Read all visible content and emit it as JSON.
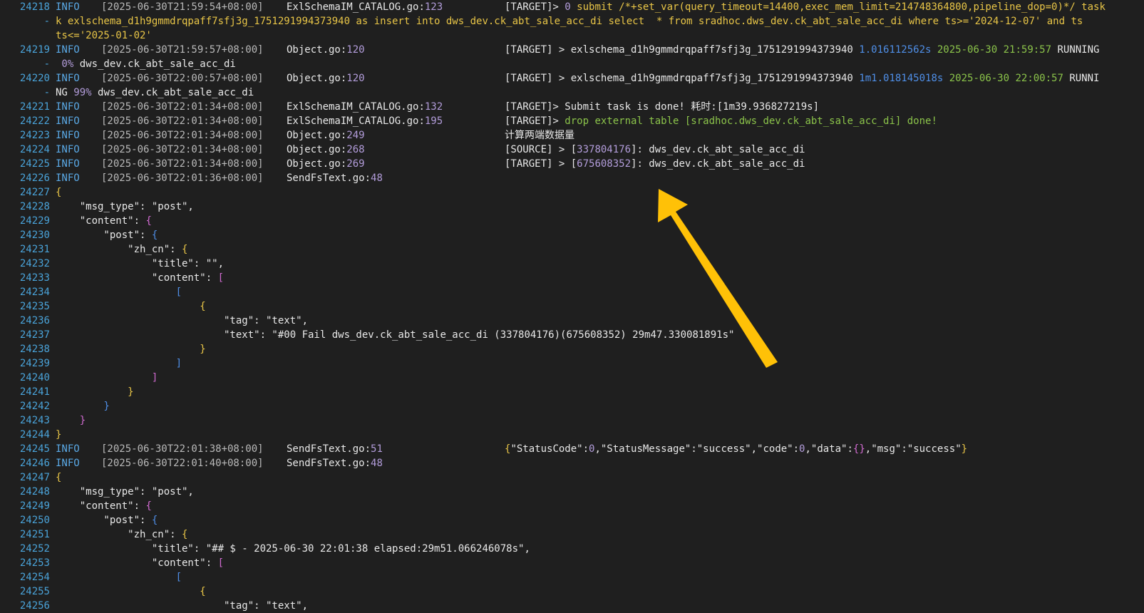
{
  "lines": [
    {
      "n": "24218",
      "lvl": "INFO",
      "ts": "[2025-06-30T21:59:54+08:00]",
      "file": "ExlSchemaIM_CATALOG.go",
      "line": "123",
      "msg": [
        {
          "t": "[TARGET]> ",
          "c": ""
        },
        {
          "t": "0",
          "c": "num"
        },
        {
          "t": " submit /*+set_var(query_timeout=14400,exec_mem_limit=214748364800,pipeline_dop=0)*/ task",
          "c": "yellow"
        }
      ]
    },
    {
      "n": "-",
      "cont": [
        {
          "t": "k exlschema_d1h9gmmdrqpaff7sfj3g_1751291994373940 as insert into dws_dev.ck_abt_sale_acc_di select  * from sradhoc.dws_dev.ck_abt_sale_acc_di where ts>='2024-12-07' and ts",
          "c": "yellow"
        }
      ]
    },
    {
      "n": "",
      "cont": [
        {
          "t": "ts<='2025-01-02'",
          "c": "yellow"
        }
      ]
    },
    {
      "n": "24219",
      "lvl": "INFO",
      "ts": "[2025-06-30T21:59:57+08:00]",
      "file": "Object.go",
      "line": "120",
      "msg": [
        {
          "t": "[TARGET] > exlschema_d1h9gmmdrqpaff7sfj3g_1751291994373940 ",
          "c": ""
        },
        {
          "t": "1.016112562s",
          "c": "blue"
        },
        {
          "t": " 2025-06-30 21:59:57 ",
          "c": "green"
        },
        {
          "t": "RUNNING",
          "c": ""
        }
      ]
    },
    {
      "n": "-",
      "cont": [
        {
          "t": " 0% ",
          "c": "num"
        },
        {
          "t": "dws_dev.ck_abt_sale_acc_di",
          "c": ""
        }
      ]
    },
    {
      "n": "24220",
      "lvl": "INFO",
      "ts": "[2025-06-30T22:00:57+08:00]",
      "file": "Object.go",
      "line": "120",
      "msg": [
        {
          "t": "[TARGET] > exlschema_d1h9gmmdrqpaff7sfj3g_1751291994373940 ",
          "c": ""
        },
        {
          "t": "1m1.018145018s",
          "c": "blue"
        },
        {
          "t": " 2025-06-30 22:00:57 ",
          "c": "green"
        },
        {
          "t": "RUNNI",
          "c": ""
        }
      ]
    },
    {
      "n": "-",
      "cont": [
        {
          "t": "NG ",
          "c": ""
        },
        {
          "t": "99%",
          "c": "num"
        },
        {
          "t": " dws_dev.ck_abt_sale_acc_di",
          "c": ""
        }
      ]
    },
    {
      "n": "24221",
      "lvl": "INFO",
      "ts": "[2025-06-30T22:01:34+08:00]",
      "file": "ExlSchemaIM_CATALOG.go",
      "line": "132",
      "msg": [
        {
          "t": "[TARGET]> Submit task is done! 耗时:",
          "c": ""
        },
        {
          "t": "[1m39.936827219s]",
          "c": ""
        }
      ]
    },
    {
      "n": "24222",
      "lvl": "INFO",
      "ts": "[2025-06-30T22:01:34+08:00]",
      "file": "ExlSchemaIM_CATALOG.go",
      "line": "195",
      "msg": [
        {
          "t": "[TARGET]> ",
          "c": ""
        },
        {
          "t": "drop external table [sradhoc.dws_dev.ck_abt_sale_acc_di] done!",
          "c": "green"
        }
      ]
    },
    {
      "n": "24223",
      "lvl": "INFO",
      "ts": "[2025-06-30T22:01:34+08:00]",
      "file": "Object.go",
      "line": "249",
      "msg": [
        {
          "t": "计算两端数据量",
          "c": ""
        }
      ]
    },
    {
      "n": "24224",
      "lvl": "INFO",
      "ts": "[2025-06-30T22:01:34+08:00]",
      "file": "Object.go",
      "line": "268",
      "msg": [
        {
          "t": "[SOURCE] > [",
          "c": ""
        },
        {
          "t": "337804176",
          "c": "num"
        },
        {
          "t": "]: dws_dev.ck_abt_sale_acc_di",
          "c": ""
        }
      ]
    },
    {
      "n": "24225",
      "lvl": "INFO",
      "ts": "[2025-06-30T22:01:34+08:00]",
      "file": "Object.go",
      "line": "269",
      "msg": [
        {
          "t": "[TARGET] > [",
          "c": ""
        },
        {
          "t": "675608352",
          "c": "num"
        },
        {
          "t": "]: dws_dev.ck_abt_sale_acc_di",
          "c": ""
        }
      ]
    },
    {
      "n": "24226",
      "lvl": "INFO",
      "ts": "[2025-06-30T22:01:36+08:00]",
      "file": "SendFsText.go",
      "line": "48",
      "msg": []
    },
    {
      "n": "24227",
      "json": [
        {
          "t": "{",
          "c": "yellow"
        }
      ]
    },
    {
      "n": "24228",
      "json": [
        {
          "t": "    \"msg_type\": \"post\",",
          "c": ""
        }
      ]
    },
    {
      "n": "24229",
      "json": [
        {
          "t": "    \"content\": ",
          "c": ""
        },
        {
          "t": "{",
          "c": "magenta"
        }
      ]
    },
    {
      "n": "24230",
      "json": [
        {
          "t": "        \"post\": ",
          "c": ""
        },
        {
          "t": "{",
          "c": "blue"
        }
      ]
    },
    {
      "n": "24231",
      "json": [
        {
          "t": "            \"zh_cn\": ",
          "c": ""
        },
        {
          "t": "{",
          "c": "yellow"
        }
      ]
    },
    {
      "n": "24232",
      "json": [
        {
          "t": "                \"title\": \"\",",
          "c": ""
        }
      ]
    },
    {
      "n": "24233",
      "json": [
        {
          "t": "                \"content\": ",
          "c": ""
        },
        {
          "t": "[",
          "c": "magenta"
        }
      ]
    },
    {
      "n": "24234",
      "json": [
        {
          "t": "                    [",
          "c": "blue"
        }
      ]
    },
    {
      "n": "24235",
      "json": [
        {
          "t": "                        {",
          "c": "yellow"
        }
      ]
    },
    {
      "n": "24236",
      "json": [
        {
          "t": "                            \"tag\": \"text\",",
          "c": ""
        }
      ]
    },
    {
      "n": "24237",
      "json": [
        {
          "t": "                            \"text\": \"#00 Fail dws_dev.ck_abt_sale_acc_di (337804176)(675608352) 29m47.330081891s\"",
          "c": ""
        }
      ]
    },
    {
      "n": "24238",
      "json": [
        {
          "t": "                        }",
          "c": "yellow"
        }
      ]
    },
    {
      "n": "24239",
      "json": [
        {
          "t": "                    ]",
          "c": "blue"
        }
      ]
    },
    {
      "n": "24240",
      "json": [
        {
          "t": "                ]",
          "c": "magenta"
        }
      ]
    },
    {
      "n": "24241",
      "json": [
        {
          "t": "            }",
          "c": "yellow"
        }
      ]
    },
    {
      "n": "24242",
      "json": [
        {
          "t": "        }",
          "c": "blue"
        }
      ]
    },
    {
      "n": "24243",
      "json": [
        {
          "t": "    }",
          "c": "magenta"
        }
      ]
    },
    {
      "n": "24244",
      "json": [
        {
          "t": "}",
          "c": "yellow"
        }
      ]
    },
    {
      "n": "24245",
      "lvl": "INFO",
      "ts": "[2025-06-30T22:01:38+08:00]",
      "file": "SendFsText.go",
      "line": "51",
      "msg": [
        {
          "t": "{",
          "c": "yellow"
        },
        {
          "t": "\"StatusCode\":",
          "c": ""
        },
        {
          "t": "0",
          "c": "num"
        },
        {
          "t": ",\"StatusMessage\":\"success\",\"code\":",
          "c": ""
        },
        {
          "t": "0",
          "c": "num"
        },
        {
          "t": ",\"data\":",
          "c": ""
        },
        {
          "t": "{}",
          "c": "magenta"
        },
        {
          "t": ",\"msg\":\"success\"",
          "c": ""
        },
        {
          "t": "}",
          "c": "yellow"
        }
      ]
    },
    {
      "n": "24246",
      "lvl": "INFO",
      "ts": "[2025-06-30T22:01:40+08:00]",
      "file": "SendFsText.go",
      "line": "48",
      "msg": []
    },
    {
      "n": "24247",
      "json": [
        {
          "t": "{",
          "c": "yellow"
        }
      ]
    },
    {
      "n": "24248",
      "json": [
        {
          "t": "    \"msg_type\": \"post\",",
          "c": ""
        }
      ]
    },
    {
      "n": "24249",
      "json": [
        {
          "t": "    \"content\": ",
          "c": ""
        },
        {
          "t": "{",
          "c": "magenta"
        }
      ]
    },
    {
      "n": "24250",
      "json": [
        {
          "t": "        \"post\": ",
          "c": ""
        },
        {
          "t": "{",
          "c": "blue"
        }
      ]
    },
    {
      "n": "24251",
      "json": [
        {
          "t": "            \"zh_cn\": ",
          "c": ""
        },
        {
          "t": "{",
          "c": "yellow"
        }
      ]
    },
    {
      "n": "24252",
      "json": [
        {
          "t": "                \"title\": \"## $ - 2025-06-30 22:01:38 elapsed:29m51.066246078s\",",
          "c": ""
        }
      ]
    },
    {
      "n": "24253",
      "json": [
        {
          "t": "                \"content\": ",
          "c": ""
        },
        {
          "t": "[",
          "c": "magenta"
        }
      ]
    },
    {
      "n": "24254",
      "json": [
        {
          "t": "                    [",
          "c": "blue"
        }
      ]
    },
    {
      "n": "24255",
      "json": [
        {
          "t": "                        {",
          "c": "yellow"
        }
      ]
    },
    {
      "n": "24256",
      "json": [
        {
          "t": "                            \"tag\": \"text\",",
          "c": ""
        }
      ]
    }
  ],
  "colors": {
    "background": "#1f1f1f",
    "arrow": "#ffc107",
    "line_number": "#4aa3d9"
  }
}
